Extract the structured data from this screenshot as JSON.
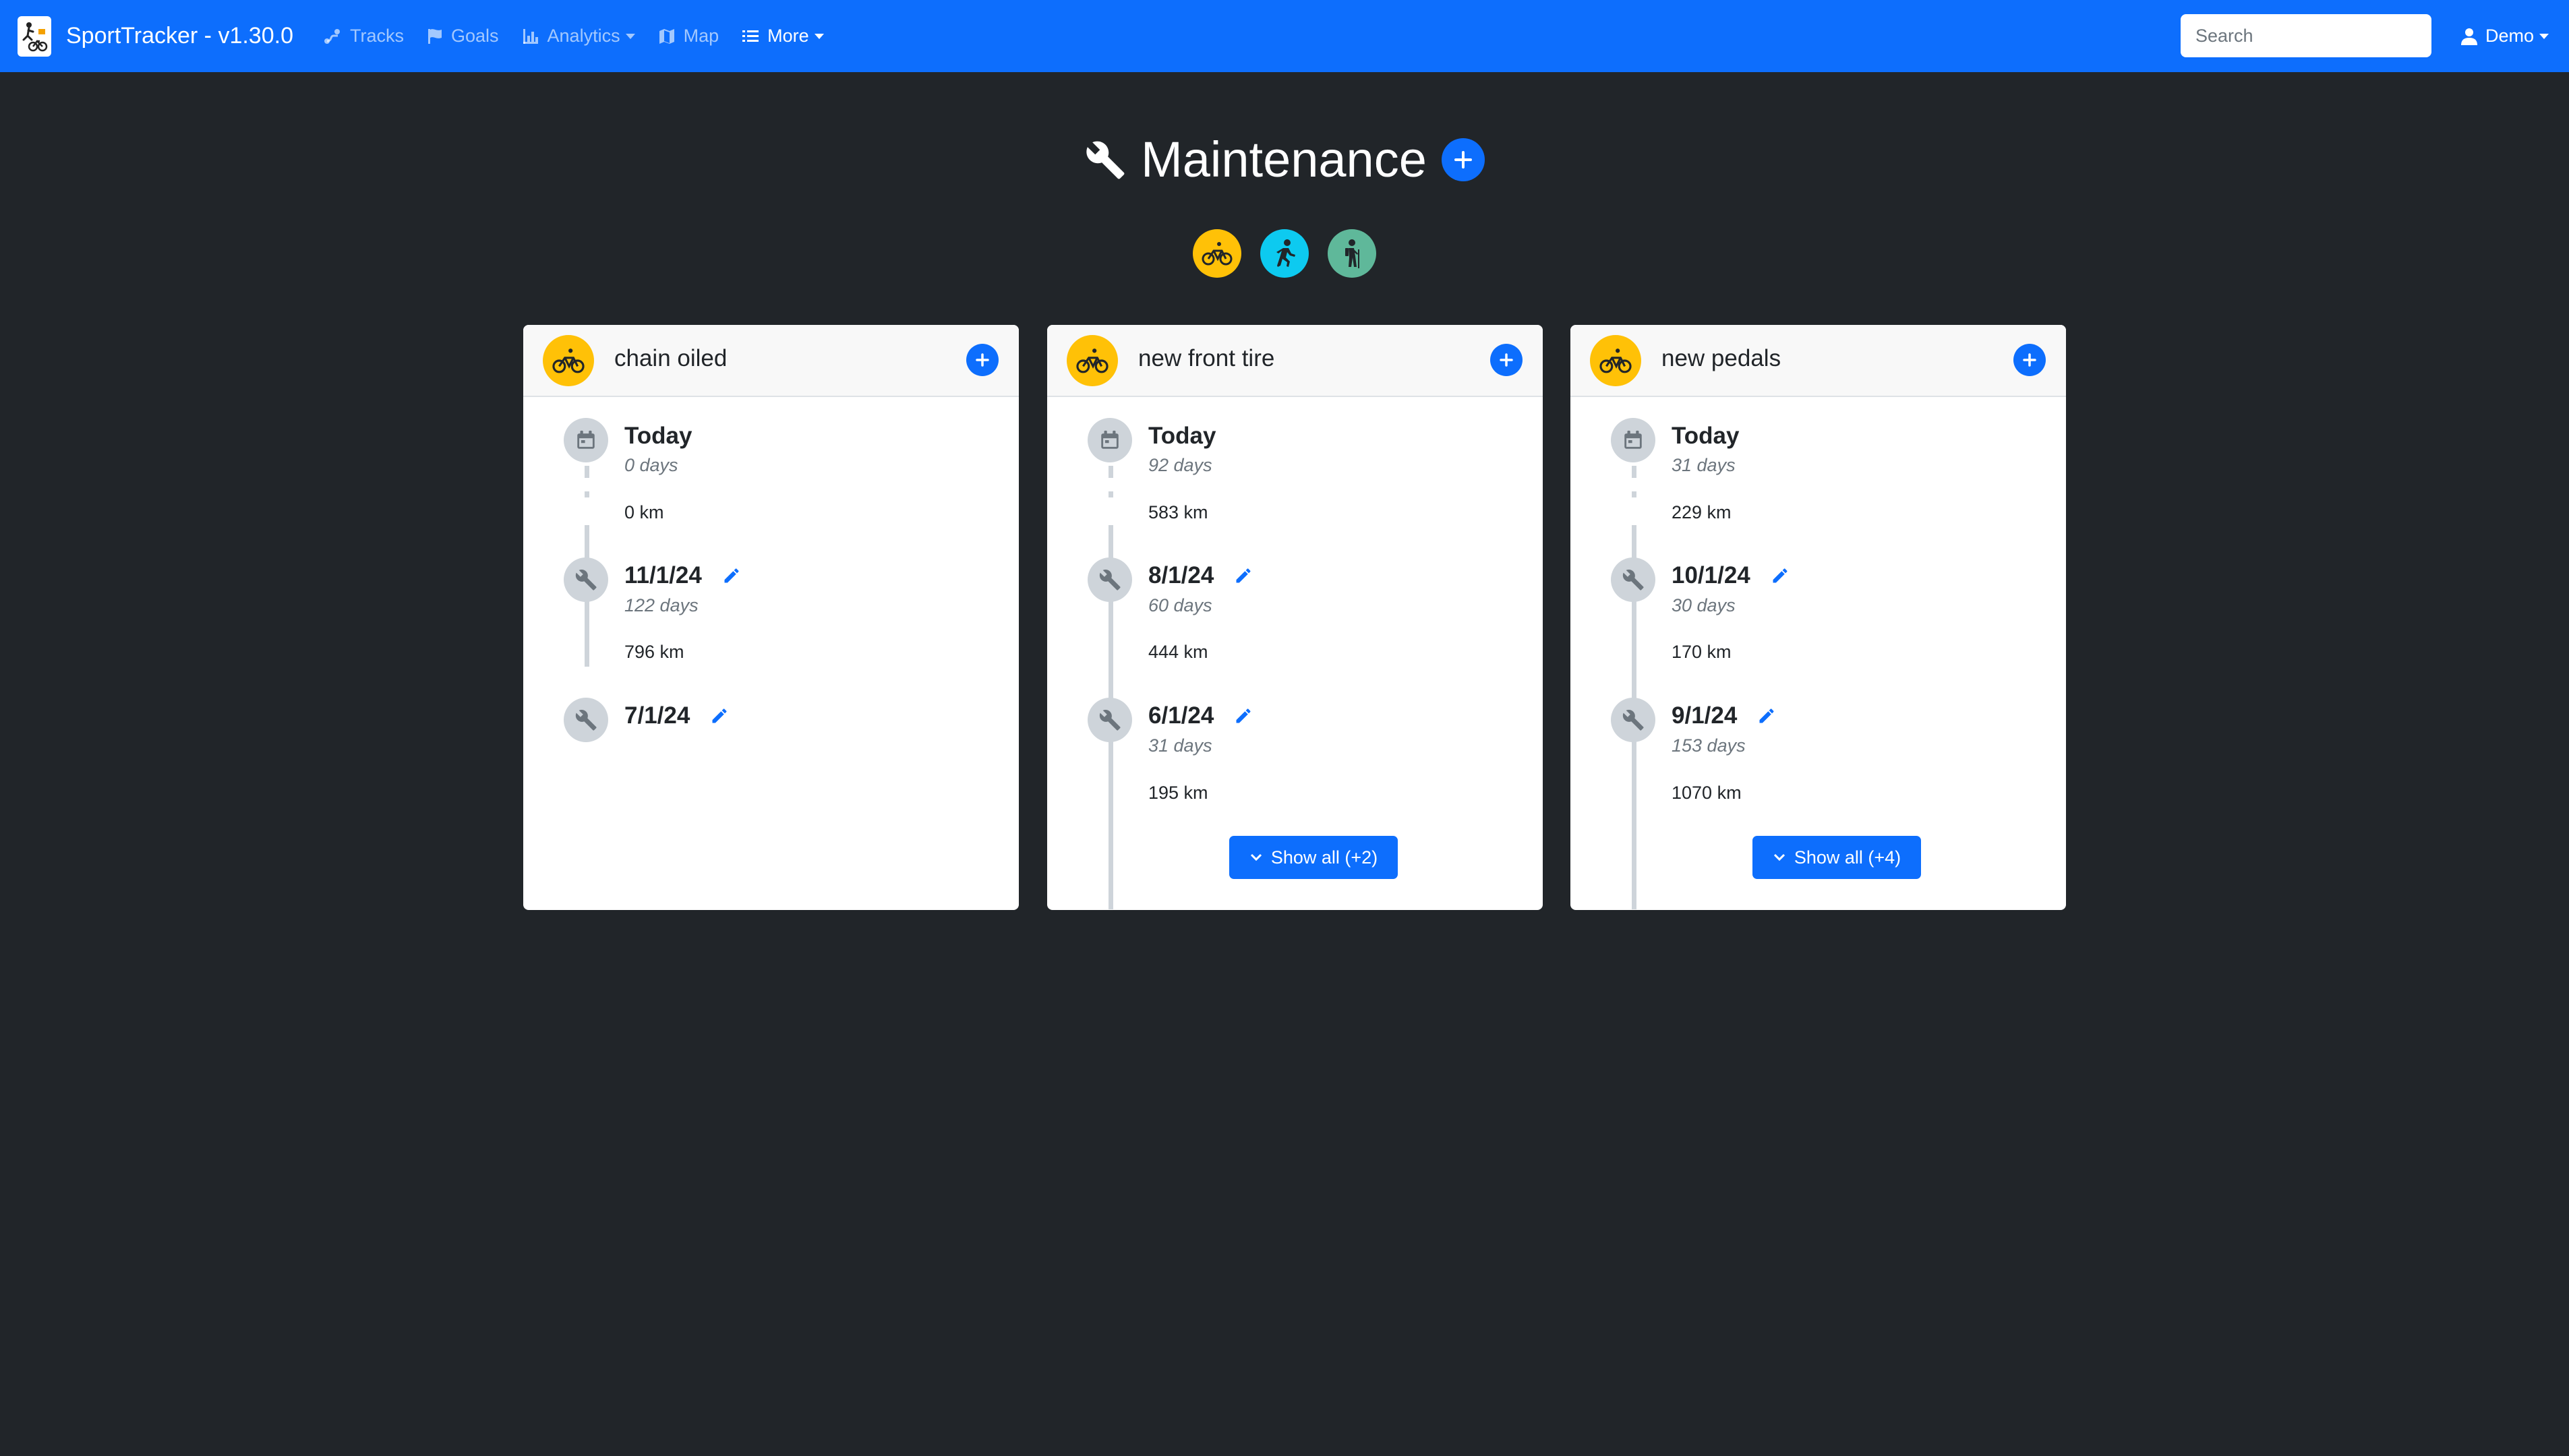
{
  "navbar": {
    "brand": "SportTracker - v1.30.0",
    "items": [
      {
        "label": "Tracks",
        "icon": "route-icon"
      },
      {
        "label": "Goals",
        "icon": "flag-icon"
      },
      {
        "label": "Analytics",
        "icon": "bar-chart-icon",
        "dropdown": true
      },
      {
        "label": "Map",
        "icon": "map-icon"
      },
      {
        "label": "More",
        "icon": "list-icon",
        "dropdown": true,
        "active": true
      }
    ],
    "search_placeholder": "Search",
    "user": "Demo"
  },
  "page": {
    "title": "Maintenance"
  },
  "filters": [
    {
      "type": "cycling",
      "color": "#ffc107"
    },
    {
      "type": "running",
      "color": "#0dcaf0"
    },
    {
      "type": "hiking",
      "color": "#5fb89a"
    }
  ],
  "cards": [
    {
      "title": "chain oiled",
      "type": "cycling",
      "today": {
        "label": "Today",
        "days": "0 days",
        "km": "0 km"
      },
      "entries": [
        {
          "date": "11/1/24",
          "days": "122 days",
          "km": "796 km"
        },
        {
          "date": "7/1/24"
        }
      ]
    },
    {
      "title": "new front tire",
      "type": "cycling",
      "today": {
        "label": "Today",
        "days": "92 days",
        "km": "583 km"
      },
      "entries": [
        {
          "date": "8/1/24",
          "days": "60 days",
          "km": "444 km"
        },
        {
          "date": "6/1/24",
          "days": "31 days",
          "km": "195 km"
        }
      ],
      "show_all": "Show all (+2)"
    },
    {
      "title": "new pedals",
      "type": "cycling",
      "today": {
        "label": "Today",
        "days": "31 days",
        "km": "229 km"
      },
      "entries": [
        {
          "date": "10/1/24",
          "days": "30 days",
          "km": "170 km"
        },
        {
          "date": "9/1/24",
          "days": "153 days",
          "km": "1070 km"
        }
      ],
      "show_all": "Show all (+4)"
    }
  ]
}
